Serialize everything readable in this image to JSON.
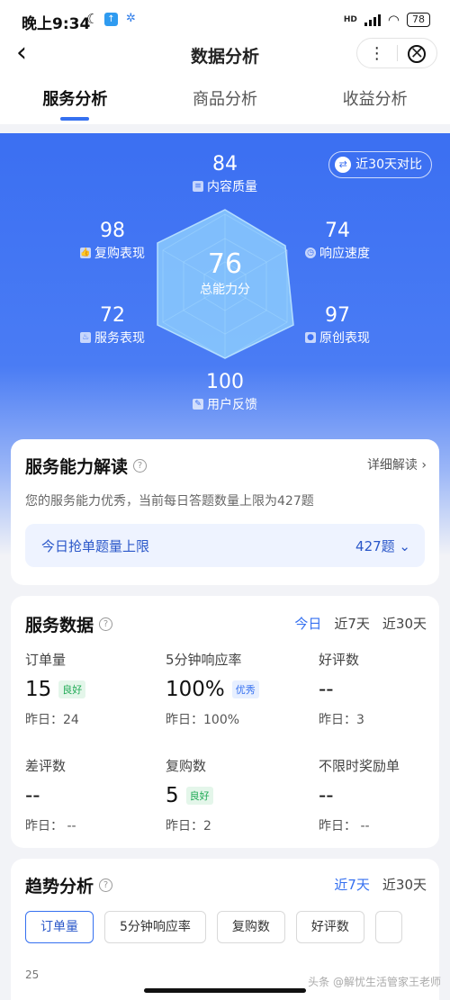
{
  "status": {
    "time": "晚上9:34",
    "net": "HD",
    "battery": "78"
  },
  "nav": {
    "title": "数据分析",
    "more": "⋮",
    "close": "✕",
    "back": "‹"
  },
  "tabs": [
    {
      "label": "服务分析"
    },
    {
      "label": "商品分析"
    },
    {
      "label": "收益分析"
    }
  ],
  "radar": {
    "compare_label": "近30天对比",
    "total": {
      "value": "76",
      "label": "总能力分"
    },
    "metrics": [
      {
        "value": "84",
        "label": "内容质量"
      },
      {
        "value": "74",
        "label": "响应速度"
      },
      {
        "value": "97",
        "label": "原创表现"
      },
      {
        "value": "100",
        "label": "用户反馈"
      },
      {
        "value": "72",
        "label": "服务表现"
      },
      {
        "value": "98",
        "label": "复购表现"
      }
    ]
  },
  "ability": {
    "title": "服务能力解读",
    "detail": "详细解读 ›",
    "desc": "您的服务能力优秀，当前每日答题数量上限为427题",
    "limit_label": "今日抢单题量上限",
    "limit_value": "427题 ⌄"
  },
  "service": {
    "title": "服务数据",
    "periods": [
      "今日",
      "近7天",
      "近30天"
    ],
    "stats": [
      {
        "name": "订单量",
        "value": "15",
        "badge": "良好",
        "yesterday": "昨日：24"
      },
      {
        "name": "5分钟响应率",
        "value": "100%",
        "badge": "优秀",
        "yesterday": "昨日：100%"
      },
      {
        "name": "好评数",
        "value": "--",
        "badge": "",
        "yesterday": "昨日：3"
      },
      {
        "name": "差评数",
        "value": "--",
        "badge": "",
        "yesterday": "昨日：  --"
      },
      {
        "name": "复购数",
        "value": "5",
        "badge": "良好",
        "yesterday": "昨日：2"
      },
      {
        "name": "不限时奖励单",
        "value": "--",
        "badge": "",
        "yesterday": "昨日：  --"
      }
    ]
  },
  "trend": {
    "title": "趋势分析",
    "periods": [
      "近7天",
      "近30天"
    ],
    "chips": [
      "订单量",
      "5分钟响应率",
      "复购数",
      "好评数"
    ],
    "y_first_tick": "25"
  },
  "watermark": "头条 @解忧生活管家王老师"
}
